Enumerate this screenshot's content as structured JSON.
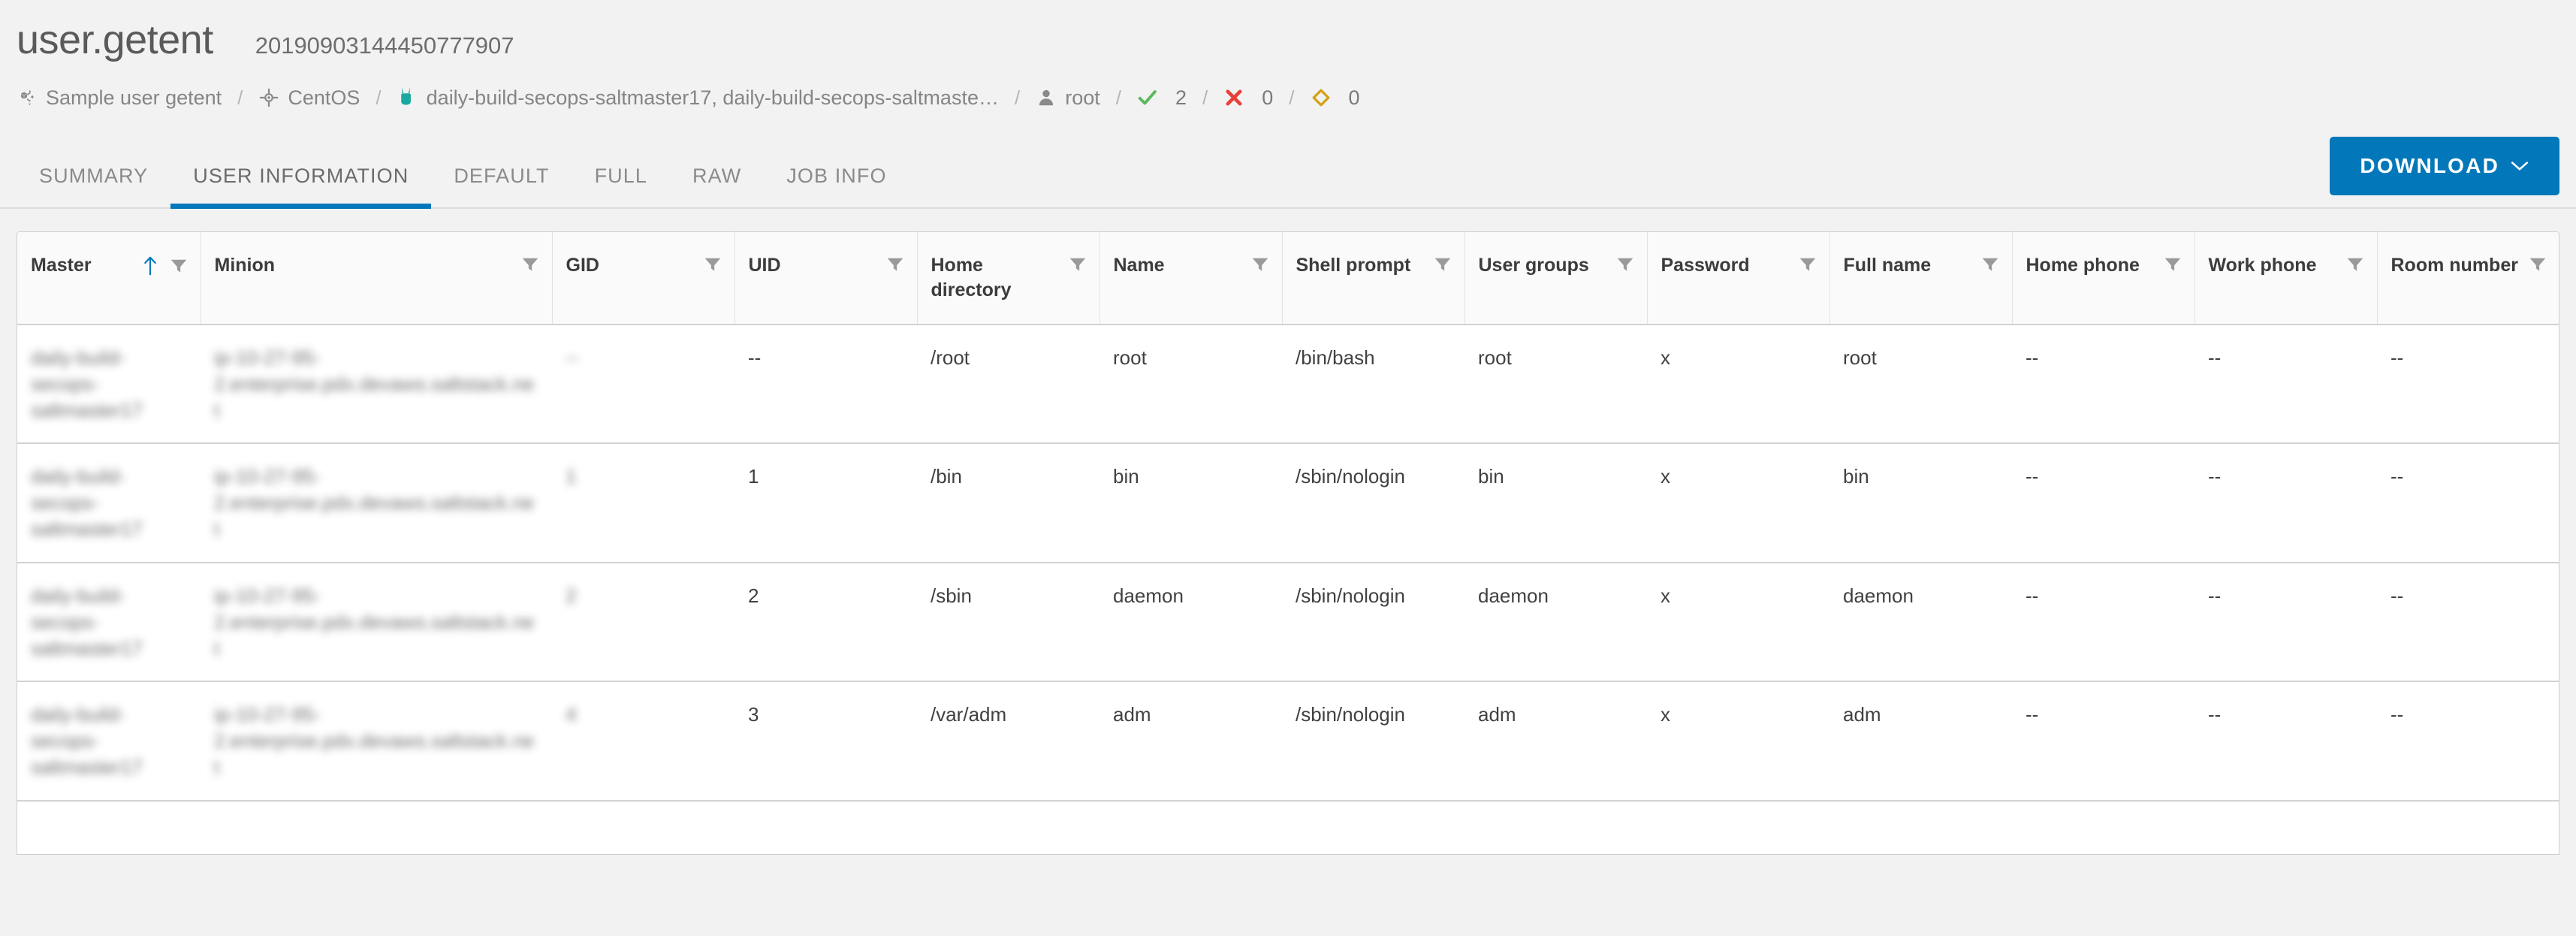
{
  "header": {
    "job_title": "user.getent",
    "job_id": "20190903144450777907",
    "breadcrumb": [
      {
        "icon": "cube-nodes-icon",
        "label": "Sample user getent"
      },
      {
        "icon": "target-icon",
        "label": "CentOS"
      },
      {
        "icon": "salt-minion-icon",
        "label": "daily-build-secops-saltmaster17, daily-build-secops-saltmaste…"
      },
      {
        "icon": "user-icon",
        "label": "root"
      },
      {
        "icon": "check-icon",
        "label": "2"
      },
      {
        "icon": "x-icon",
        "label": "0"
      },
      {
        "icon": "diamond-icon",
        "label": "0"
      }
    ],
    "separator": "/"
  },
  "tabs": [
    {
      "label": "SUMMARY",
      "active": false
    },
    {
      "label": "USER INFORMATION",
      "active": true
    },
    {
      "label": "DEFAULT",
      "active": false
    },
    {
      "label": "FULL",
      "active": false
    },
    {
      "label": "RAW",
      "active": false
    },
    {
      "label": "JOB INFO",
      "active": false
    }
  ],
  "toolbar": {
    "download_label": "DOWNLOAD",
    "download_caret": "chevron-down-icon"
  },
  "colors": {
    "accent": "#0278ba",
    "success": "#5cb85c",
    "error": "#e8413a",
    "warning": "#d4a017",
    "minion_teal": "#1aa8a0",
    "page_bg": "#f2f2f2",
    "table_header_bg": "#fafafa",
    "border": "#d2d2d2"
  },
  "table": {
    "sort": {
      "column": "Master",
      "direction": "asc",
      "icon": "arrow-up-icon"
    },
    "filter_icon": "filter-funnel-icon",
    "columns": [
      {
        "label": "Master",
        "key": "master",
        "sorted": true,
        "filterable": true
      },
      {
        "label": "Minion",
        "key": "minion",
        "sorted": false,
        "filterable": true
      },
      {
        "label": "GID",
        "key": "gid",
        "sorted": false,
        "filterable": true
      },
      {
        "label": "UID",
        "key": "uid",
        "sorted": false,
        "filterable": true
      },
      {
        "label": "Home directory",
        "key": "home",
        "sorted": false,
        "filterable": true
      },
      {
        "label": "Name",
        "key": "name",
        "sorted": false,
        "filterable": true
      },
      {
        "label": "Shell prompt",
        "key": "shell",
        "sorted": false,
        "filterable": true
      },
      {
        "label": "User groups",
        "key": "groups",
        "sorted": false,
        "filterable": true
      },
      {
        "label": "Password",
        "key": "pass",
        "sorted": false,
        "filterable": true
      },
      {
        "label": "Full name",
        "key": "full",
        "sorted": false,
        "filterable": true
      },
      {
        "label": "Home phone",
        "key": "hphone",
        "sorted": false,
        "filterable": true
      },
      {
        "label": "Work phone",
        "key": "wphone",
        "sorted": false,
        "filterable": true
      },
      {
        "label": "Room number",
        "key": "room",
        "sorted": false,
        "filterable": true
      }
    ],
    "rows": [
      {
        "master": "daily-build-secops-saltmaster17",
        "minion": "ip-10-27-95-2.enterprise.pdx.devaws.saltstack.net",
        "gid": "--",
        "uid": "--",
        "home": "/root",
        "name": "root",
        "shell": "/bin/bash",
        "groups": "root",
        "pass": "x",
        "full": "root",
        "hphone": "--",
        "wphone": "--",
        "room": "--",
        "redacted": [
          "master",
          "minion",
          "gid"
        ]
      },
      {
        "master": "daily-build-secops-saltmaster17",
        "minion": "ip-10-27-95-2.enterprise.pdx.devaws.saltstack.net",
        "gid": "1",
        "uid": "1",
        "home": "/bin",
        "name": "bin",
        "shell": "/sbin/nologin",
        "groups": "bin",
        "pass": "x",
        "full": "bin",
        "hphone": "--",
        "wphone": "--",
        "room": "--",
        "redacted": [
          "master",
          "minion",
          "gid"
        ]
      },
      {
        "master": "daily-build-secops-saltmaster17",
        "minion": "ip-10-27-95-2.enterprise.pdx.devaws.saltstack.net",
        "gid": "2",
        "uid": "2",
        "home": "/sbin",
        "name": "daemon",
        "shell": "/sbin/nologin",
        "groups": "daemon",
        "pass": "x",
        "full": "daemon",
        "hphone": "--",
        "wphone": "--",
        "room": "--",
        "redacted": [
          "master",
          "minion",
          "gid"
        ]
      },
      {
        "master": "daily-build-secops-saltmaster17",
        "minion": "ip-10-27-95-2.enterprise.pdx.devaws.saltstack.net",
        "gid": "4",
        "uid": "3",
        "home": "/var/adm",
        "name": "adm",
        "shell": "/sbin/nologin",
        "groups": "adm",
        "pass": "x",
        "full": "adm",
        "hphone": "--",
        "wphone": "--",
        "room": "--",
        "redacted": [
          "master",
          "minion",
          "gid"
        ]
      }
    ]
  }
}
